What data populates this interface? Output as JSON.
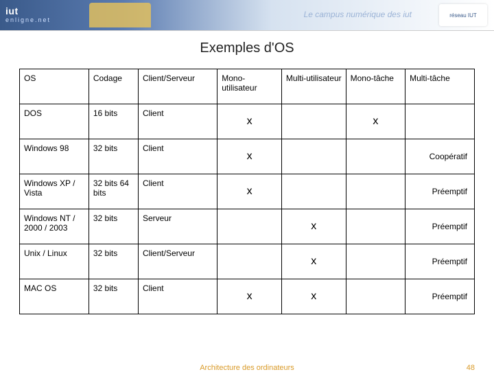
{
  "banner": {
    "logo_main": "iut",
    "logo_sub": "enligne.net",
    "tagline": "Le campus numérique des iut",
    "badge": "réseau IUT"
  },
  "title": "Exemples d'OS",
  "chart_data": {
    "type": "table",
    "columns": [
      "OS",
      "Codage",
      "Client/Serveur",
      "Mono-utilisateur",
      "Multi-utilisateur",
      "Mono-tâche",
      "Multi-tâche"
    ],
    "rows": [
      {
        "os": "DOS",
        "codage": "16 bits",
        "cs": "Client",
        "mono_u": "x",
        "multi_u": "",
        "mono_t": "x",
        "multi_t": ""
      },
      {
        "os": "Windows 98",
        "codage": "32 bits",
        "cs": "Client",
        "mono_u": "x",
        "multi_u": "",
        "mono_t": "",
        "multi_t": "Coopératif"
      },
      {
        "os": "Windows XP / Vista",
        "codage": "32 bits 64 bits",
        "cs": "Client",
        "mono_u": "x",
        "multi_u": "",
        "mono_t": "",
        "multi_t": "Préemptif"
      },
      {
        "os": "Windows NT / 2000 / 2003",
        "codage": "32 bits",
        "cs": "Serveur",
        "mono_u": "",
        "multi_u": "x",
        "mono_t": "",
        "multi_t": "Préemptif"
      },
      {
        "os": "Unix / Linux",
        "codage": "32 bits",
        "cs": "Client/Serveur",
        "mono_u": "",
        "multi_u": "x",
        "mono_t": "",
        "multi_t": "Préemptif"
      },
      {
        "os": "MAC OS",
        "codage": "32 bits",
        "cs": "Client",
        "mono_u": "x",
        "multi_u": "x",
        "mono_t": "",
        "multi_t": "Préemptif"
      }
    ]
  },
  "footer": {
    "text": "Architecture des ordinateurs",
    "page": "48"
  }
}
